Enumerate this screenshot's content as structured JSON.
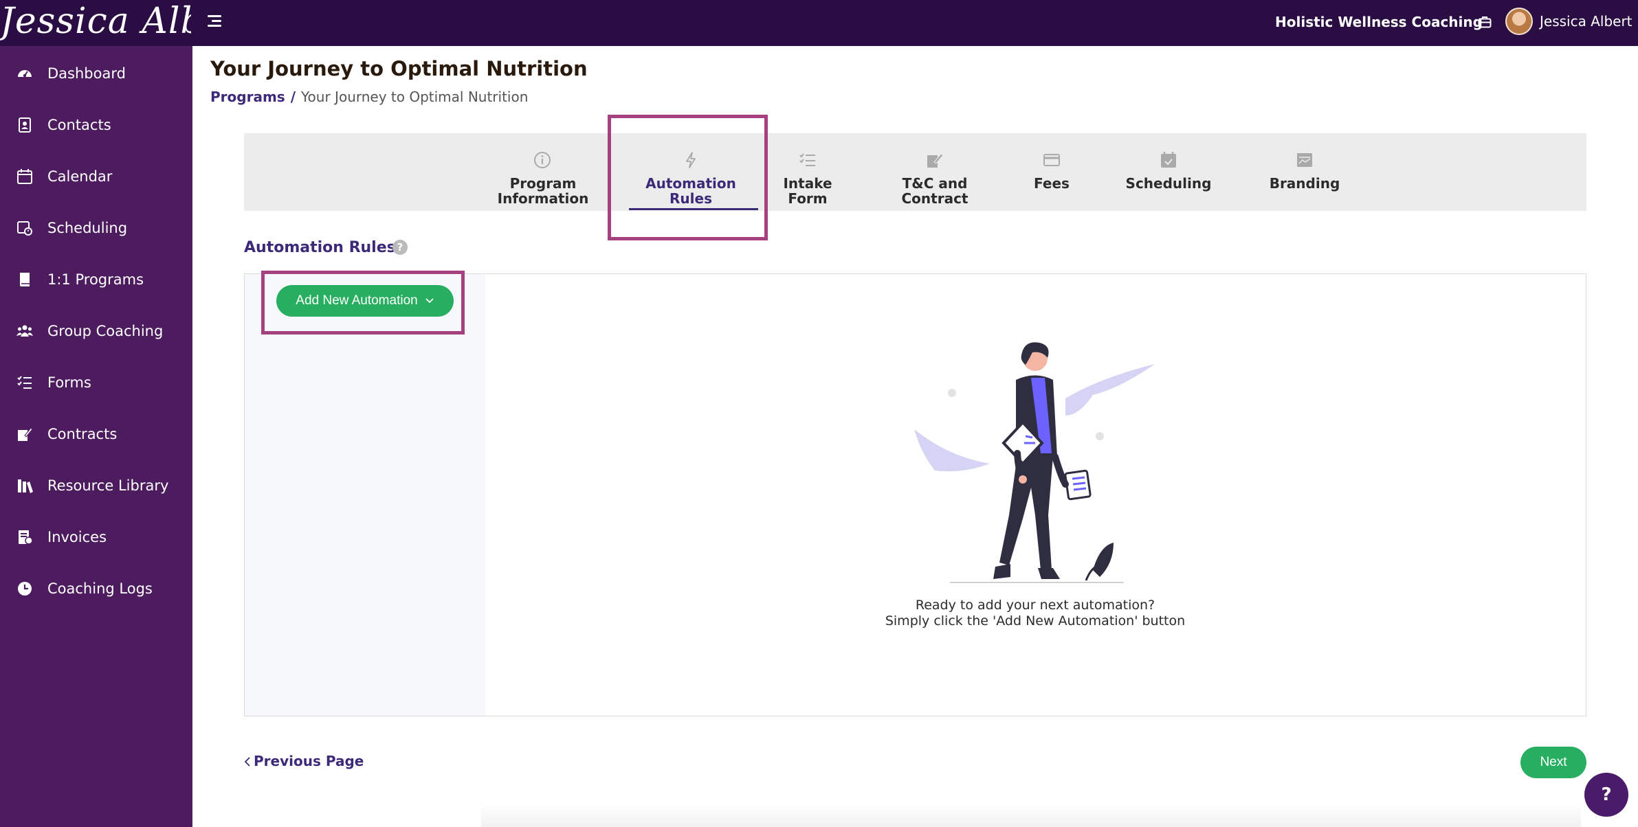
{
  "header": {
    "logo_text": "Jessica Albert",
    "business_name": "Holistic Wellness Coaching",
    "user_name": "Jessica Albert"
  },
  "sidebar": {
    "items": [
      {
        "label": "Dashboard",
        "icon": "dashboard-icon"
      },
      {
        "label": "Contacts",
        "icon": "contacts-icon"
      },
      {
        "label": "Calendar",
        "icon": "calendar-icon"
      },
      {
        "label": "Scheduling",
        "icon": "scheduling-icon"
      },
      {
        "label": "1:1 Programs",
        "icon": "book-icon"
      },
      {
        "label": "Group Coaching",
        "icon": "group-icon"
      },
      {
        "label": "Forms",
        "icon": "checklist-icon"
      },
      {
        "label": "Contracts",
        "icon": "signature-icon"
      },
      {
        "label": "Resource Library",
        "icon": "library-icon"
      },
      {
        "label": "Invoices",
        "icon": "invoice-icon"
      },
      {
        "label": "Coaching Logs",
        "icon": "clock-icon"
      }
    ]
  },
  "page": {
    "title": "Your Journey to Optimal Nutrition",
    "breadcrumb": {
      "parent": "Programs",
      "separator": "/",
      "current": "Your Journey to Optimal Nutrition"
    }
  },
  "tabs": [
    {
      "line1": "Program",
      "line2": "Information",
      "icon": "info-icon"
    },
    {
      "line1": "Automation",
      "line2": "Rules",
      "icon": "lightning-icon",
      "active": true
    },
    {
      "line1": "Intake",
      "line2": "Form",
      "icon": "checklist-icon"
    },
    {
      "line1": "T&C and",
      "line2": "Contract",
      "icon": "contract-icon"
    },
    {
      "line1": "Fees",
      "line2": "",
      "icon": "credit-card-icon"
    },
    {
      "line1": "Scheduling",
      "line2": "",
      "icon": "calendar-check-icon"
    },
    {
      "line1": "Branding",
      "line2": "",
      "icon": "branding-icon"
    }
  ],
  "automation": {
    "section_title": "Automation Rules",
    "help_glyph": "?",
    "add_button": "Add New Automation",
    "empty_line1": "Ready to add your next automation?",
    "empty_line2": "Simply click the 'Add New Automation' button"
  },
  "footer": {
    "previous": "Previous Page",
    "next": "Next",
    "help_fab": "?"
  },
  "colors": {
    "topbar": "#2a0e43",
    "sidebar": "#4d1c5e",
    "accent": "#3c2a78",
    "green": "#27ae60",
    "highlight": "#a5417f"
  }
}
